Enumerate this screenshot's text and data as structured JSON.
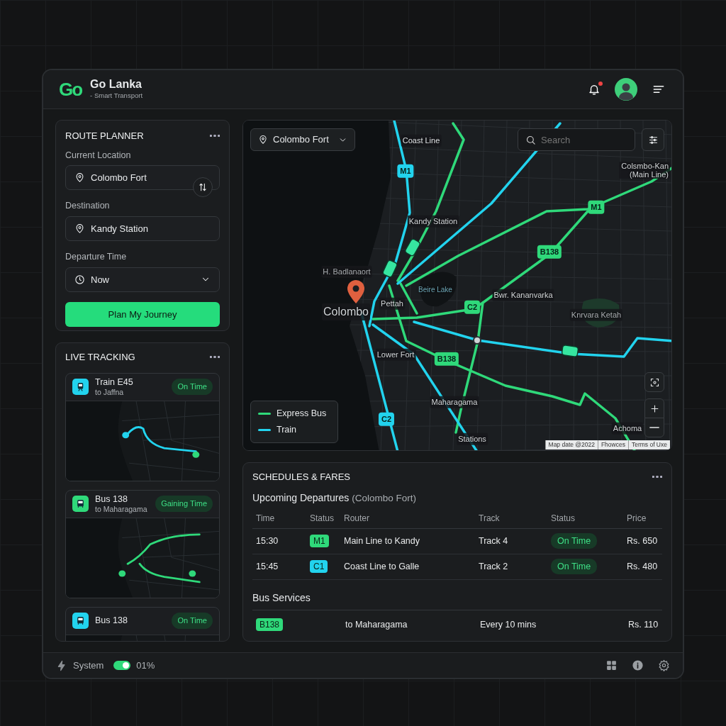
{
  "header": {
    "logo": "Go",
    "title": "Go Lanka",
    "subtitle": "- Smart Transport",
    "has_notification": true
  },
  "route_planner": {
    "title": "ROUTE PLANNER",
    "fields": [
      {
        "label": "Current Location",
        "value": "Colombo Fort",
        "kind": "location"
      },
      {
        "label": "Destination",
        "value": "Kandy Station",
        "kind": "location"
      },
      {
        "label": "Departure Time",
        "value": "Now",
        "kind": "time"
      }
    ],
    "button": "Plan My Journey"
  },
  "live_tracking": {
    "title": "LIVE TRACKING",
    "items": [
      {
        "kind": "train",
        "title": "Train E45",
        "subtitle": "to Jaffna",
        "status": "On Time",
        "color": "#22d3ee"
      },
      {
        "kind": "bus",
        "title": "Bus 138",
        "subtitle": "to Maharagama",
        "status": "Gaining Time",
        "color": "#2fd97a"
      },
      {
        "kind": "bus",
        "title": "Bus 138",
        "status": "On Time",
        "color": "#22d3ee"
      }
    ]
  },
  "map": {
    "location": "Colombo Fort",
    "search": {
      "placeholder": "Search"
    },
    "legend": [
      {
        "label": "Express Bus",
        "color": "#2fd97a"
      },
      {
        "label": "Train",
        "color": "#22d3ee"
      }
    ],
    "labels": [
      {
        "text": "Coast Line",
        "kind": "station"
      },
      {
        "text": "M1",
        "kind": "route",
        "color": "#22d3ee"
      },
      {
        "text": "Kandy Station",
        "kind": "place"
      },
      {
        "text": "H. Badlanaort",
        "kind": "poi"
      },
      {
        "text": "Colombo",
        "kind": "city"
      },
      {
        "text": "Pettah",
        "kind": "place"
      },
      {
        "text": "Beire Lake",
        "kind": "water"
      },
      {
        "text": "C2",
        "kind": "route",
        "color": "#2fd97a"
      },
      {
        "text": "Bwr. Kananvarka",
        "kind": "place"
      },
      {
        "text": "B138",
        "kind": "route",
        "color": "#2fd97a"
      },
      {
        "text": "M1",
        "kind": "route",
        "color": "#2fd97a"
      },
      {
        "text": "Colsmbo-Kan (Main Line)",
        "kind": "place"
      },
      {
        "text": "Knrvara Ketah",
        "kind": "poi"
      },
      {
        "text": "Lower Fort",
        "kind": "place"
      },
      {
        "text": "B138",
        "kind": "route",
        "color": "#2fd97a"
      },
      {
        "text": "Maharagama",
        "kind": "place"
      },
      {
        "text": "C2",
        "kind": "route",
        "color": "#22d3ee"
      },
      {
        "text": "Stations",
        "kind": "place"
      },
      {
        "text": "Achoma",
        "kind": "place"
      }
    ],
    "attribution": [
      "Map date @2022",
      "Fhowces",
      "Terms of Uxe"
    ]
  },
  "schedules": {
    "title": "SCHEDULES & FARES",
    "heading": "Upcoming Departures",
    "heading_note": "(Colombo Fort)",
    "columns": [
      "Time",
      "Status",
      "Router",
      "Track",
      "Status",
      "Price"
    ],
    "rows": [
      {
        "time": "15:30",
        "code": "M1",
        "color": "#2fd97a",
        "route": "Main Line to Kandy",
        "track": "Track 4",
        "status": "On Time",
        "price": "Rs. 650"
      },
      {
        "time": "15:45",
        "code": "C1",
        "color": "#22d3ee",
        "route": "Coast Line to Galle",
        "track": "Track 2",
        "status": "On Time",
        "price": "Rs. 480"
      }
    ],
    "bus_heading": "Bus Services",
    "bus_rows": [
      {
        "code": "B138",
        "color": "#2fd97a",
        "route": "to Maharagama",
        "frequency": "Every 10 mins",
        "price": "Rs. 110"
      }
    ]
  },
  "status_bar": {
    "label": "System",
    "on": true,
    "reading": "01%"
  }
}
